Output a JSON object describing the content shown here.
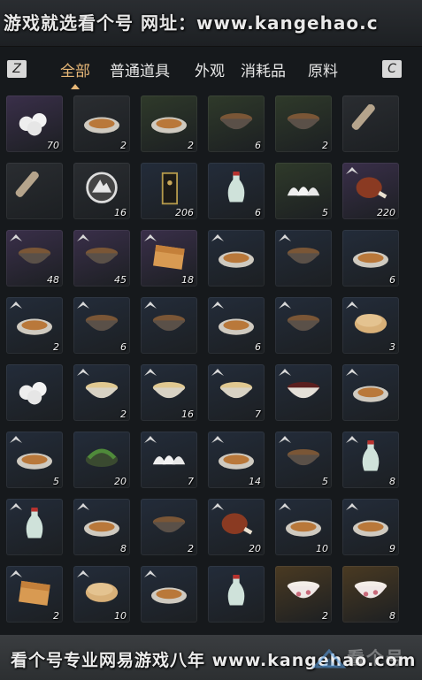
{
  "watermark_top": "游戏就选看个号  网址：www.kangehao.c",
  "watermark_bottom": "看个号专业网易游戏八年 www.kangehao.com",
  "logo_text": "看个号",
  "keys": {
    "prev": "Z",
    "next": "C"
  },
  "tabs": [
    {
      "label": "全部",
      "active": true
    },
    {
      "label": "普通道具",
      "active": false
    },
    {
      "label": "外观",
      "active": false
    },
    {
      "label": "消耗品",
      "active": false
    },
    {
      "label": "原料",
      "active": false
    }
  ],
  "rarity_colors": {
    "purple": "#3a2f4a",
    "gold": "#4a3a22",
    "green": "#2f3a2a",
    "blue": "#232c3a",
    "gray": "#2a2d31"
  },
  "items": [
    {
      "icon": "steamed-bun-icon",
      "qty": "70",
      "bg": "purple"
    },
    {
      "icon": "dish-icon",
      "qty": "2",
      "bg": "gray"
    },
    {
      "icon": "dish-icon",
      "qty": "2",
      "bg": "green"
    },
    {
      "icon": "bowl-icon",
      "qty": "6",
      "bg": "green"
    },
    {
      "icon": "bowl-icon",
      "qty": "2",
      "bg": "green"
    },
    {
      "icon": "scroll-icon",
      "qty": "",
      "bg": "gray"
    },
    {
      "icon": "scroll-icon",
      "qty": "",
      "bg": "gray"
    },
    {
      "icon": "coin-icon",
      "qty": "16",
      "bg": "gray"
    },
    {
      "icon": "ticket-icon",
      "qty": "206",
      "bg": "blue"
    },
    {
      "icon": "vase-icon",
      "qty": "6",
      "bg": "blue"
    },
    {
      "icon": "dumpling-icon",
      "qty": "5",
      "bg": "green"
    },
    {
      "icon": "meat-icon",
      "qty": "220",
      "bg": "purple"
    },
    {
      "icon": "bowl-icon",
      "qty": "48",
      "bg": "purple"
    },
    {
      "icon": "bowl-icon",
      "qty": "45",
      "bg": "purple"
    },
    {
      "icon": "cake-icon",
      "qty": "18",
      "bg": "purple"
    },
    {
      "icon": "dish-icon",
      "qty": "",
      "bg": "blue"
    },
    {
      "icon": "bowl-icon",
      "qty": "",
      "bg": "blue"
    },
    {
      "icon": "dish-icon",
      "qty": "6",
      "bg": "blue"
    },
    {
      "icon": "dish-icon",
      "qty": "2",
      "bg": "blue"
    },
    {
      "icon": "bowl-icon",
      "qty": "6",
      "bg": "blue"
    },
    {
      "icon": "bowl-icon",
      "qty": "",
      "bg": "blue"
    },
    {
      "icon": "dish-icon",
      "qty": "6",
      "bg": "blue"
    },
    {
      "icon": "bowl-icon",
      "qty": "",
      "bg": "blue"
    },
    {
      "icon": "pancake-icon",
      "qty": "3",
      "bg": "blue"
    },
    {
      "icon": "steamed-bun-icon",
      "qty": "",
      "bg": "blue"
    },
    {
      "icon": "noodle-bowl-icon",
      "qty": "2",
      "bg": "blue"
    },
    {
      "icon": "noodle-bowl-icon",
      "qty": "16",
      "bg": "blue"
    },
    {
      "icon": "noodle-bowl-icon",
      "qty": "7",
      "bg": "blue"
    },
    {
      "icon": "soup-bowl-icon",
      "qty": "",
      "bg": "blue"
    },
    {
      "icon": "dish-icon",
      "qty": "",
      "bg": "blue"
    },
    {
      "icon": "dish-icon",
      "qty": "5",
      "bg": "blue"
    },
    {
      "icon": "greens-icon",
      "qty": "20",
      "bg": "blue"
    },
    {
      "icon": "dumpling-icon",
      "qty": "7",
      "bg": "blue"
    },
    {
      "icon": "dish-icon",
      "qty": "14",
      "bg": "blue"
    },
    {
      "icon": "bowl-icon",
      "qty": "5",
      "bg": "blue"
    },
    {
      "icon": "vase-icon",
      "qty": "8",
      "bg": "blue"
    },
    {
      "icon": "vase-icon",
      "qty": "",
      "bg": "blue"
    },
    {
      "icon": "dish-icon",
      "qty": "8",
      "bg": "blue"
    },
    {
      "icon": "bowl-icon",
      "qty": "2",
      "bg": "blue"
    },
    {
      "icon": "meat-icon",
      "qty": "20",
      "bg": "blue"
    },
    {
      "icon": "dish-icon",
      "qty": "10",
      "bg": "blue"
    },
    {
      "icon": "dish-icon",
      "qty": "9",
      "bg": "blue"
    },
    {
      "icon": "cake-icon",
      "qty": "2",
      "bg": "blue"
    },
    {
      "icon": "pancake-icon",
      "qty": "10",
      "bg": "blue"
    },
    {
      "icon": "dish-icon",
      "qty": "",
      "bg": "blue"
    },
    {
      "icon": "vase-icon",
      "qty": "",
      "bg": "blue"
    },
    {
      "icon": "porcelain-bowl-icon",
      "qty": "2",
      "bg": "gold"
    },
    {
      "icon": "porcelain-bowl-icon",
      "qty": "8",
      "bg": "gold"
    }
  ]
}
